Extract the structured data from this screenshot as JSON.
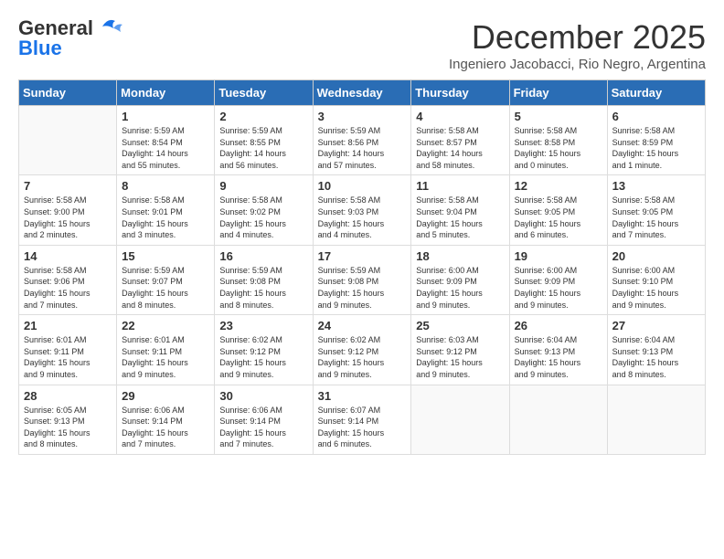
{
  "header": {
    "logo_line1": "General",
    "logo_line2": "Blue",
    "month": "December 2025",
    "location": "Ingeniero Jacobacci, Rio Negro, Argentina"
  },
  "weekdays": [
    "Sunday",
    "Monday",
    "Tuesday",
    "Wednesday",
    "Thursday",
    "Friday",
    "Saturday"
  ],
  "weeks": [
    [
      {
        "day": "",
        "info": ""
      },
      {
        "day": "1",
        "info": "Sunrise: 5:59 AM\nSunset: 8:54 PM\nDaylight: 14 hours\nand 55 minutes."
      },
      {
        "day": "2",
        "info": "Sunrise: 5:59 AM\nSunset: 8:55 PM\nDaylight: 14 hours\nand 56 minutes."
      },
      {
        "day": "3",
        "info": "Sunrise: 5:59 AM\nSunset: 8:56 PM\nDaylight: 14 hours\nand 57 minutes."
      },
      {
        "day": "4",
        "info": "Sunrise: 5:58 AM\nSunset: 8:57 PM\nDaylight: 14 hours\nand 58 minutes."
      },
      {
        "day": "5",
        "info": "Sunrise: 5:58 AM\nSunset: 8:58 PM\nDaylight: 15 hours\nand 0 minutes."
      },
      {
        "day": "6",
        "info": "Sunrise: 5:58 AM\nSunset: 8:59 PM\nDaylight: 15 hours\nand 1 minute."
      }
    ],
    [
      {
        "day": "7",
        "info": "Sunrise: 5:58 AM\nSunset: 9:00 PM\nDaylight: 15 hours\nand 2 minutes."
      },
      {
        "day": "8",
        "info": "Sunrise: 5:58 AM\nSunset: 9:01 PM\nDaylight: 15 hours\nand 3 minutes."
      },
      {
        "day": "9",
        "info": "Sunrise: 5:58 AM\nSunset: 9:02 PM\nDaylight: 15 hours\nand 4 minutes."
      },
      {
        "day": "10",
        "info": "Sunrise: 5:58 AM\nSunset: 9:03 PM\nDaylight: 15 hours\nand 4 minutes."
      },
      {
        "day": "11",
        "info": "Sunrise: 5:58 AM\nSunset: 9:04 PM\nDaylight: 15 hours\nand 5 minutes."
      },
      {
        "day": "12",
        "info": "Sunrise: 5:58 AM\nSunset: 9:05 PM\nDaylight: 15 hours\nand 6 minutes."
      },
      {
        "day": "13",
        "info": "Sunrise: 5:58 AM\nSunset: 9:05 PM\nDaylight: 15 hours\nand 7 minutes."
      }
    ],
    [
      {
        "day": "14",
        "info": "Sunrise: 5:58 AM\nSunset: 9:06 PM\nDaylight: 15 hours\nand 7 minutes."
      },
      {
        "day": "15",
        "info": "Sunrise: 5:59 AM\nSunset: 9:07 PM\nDaylight: 15 hours\nand 8 minutes."
      },
      {
        "day": "16",
        "info": "Sunrise: 5:59 AM\nSunset: 9:08 PM\nDaylight: 15 hours\nand 8 minutes."
      },
      {
        "day": "17",
        "info": "Sunrise: 5:59 AM\nSunset: 9:08 PM\nDaylight: 15 hours\nand 9 minutes."
      },
      {
        "day": "18",
        "info": "Sunrise: 6:00 AM\nSunset: 9:09 PM\nDaylight: 15 hours\nand 9 minutes."
      },
      {
        "day": "19",
        "info": "Sunrise: 6:00 AM\nSunset: 9:09 PM\nDaylight: 15 hours\nand 9 minutes."
      },
      {
        "day": "20",
        "info": "Sunrise: 6:00 AM\nSunset: 9:10 PM\nDaylight: 15 hours\nand 9 minutes."
      }
    ],
    [
      {
        "day": "21",
        "info": "Sunrise: 6:01 AM\nSunset: 9:11 PM\nDaylight: 15 hours\nand 9 minutes."
      },
      {
        "day": "22",
        "info": "Sunrise: 6:01 AM\nSunset: 9:11 PM\nDaylight: 15 hours\nand 9 minutes."
      },
      {
        "day": "23",
        "info": "Sunrise: 6:02 AM\nSunset: 9:12 PM\nDaylight: 15 hours\nand 9 minutes."
      },
      {
        "day": "24",
        "info": "Sunrise: 6:02 AM\nSunset: 9:12 PM\nDaylight: 15 hours\nand 9 minutes."
      },
      {
        "day": "25",
        "info": "Sunrise: 6:03 AM\nSunset: 9:12 PM\nDaylight: 15 hours\nand 9 minutes."
      },
      {
        "day": "26",
        "info": "Sunrise: 6:04 AM\nSunset: 9:13 PM\nDaylight: 15 hours\nand 9 minutes."
      },
      {
        "day": "27",
        "info": "Sunrise: 6:04 AM\nSunset: 9:13 PM\nDaylight: 15 hours\nand 8 minutes."
      }
    ],
    [
      {
        "day": "28",
        "info": "Sunrise: 6:05 AM\nSunset: 9:13 PM\nDaylight: 15 hours\nand 8 minutes."
      },
      {
        "day": "29",
        "info": "Sunrise: 6:06 AM\nSunset: 9:14 PM\nDaylight: 15 hours\nand 7 minutes."
      },
      {
        "day": "30",
        "info": "Sunrise: 6:06 AM\nSunset: 9:14 PM\nDaylight: 15 hours\nand 7 minutes."
      },
      {
        "day": "31",
        "info": "Sunrise: 6:07 AM\nSunset: 9:14 PM\nDaylight: 15 hours\nand 6 minutes."
      },
      {
        "day": "",
        "info": ""
      },
      {
        "day": "",
        "info": ""
      },
      {
        "day": "",
        "info": ""
      }
    ]
  ]
}
